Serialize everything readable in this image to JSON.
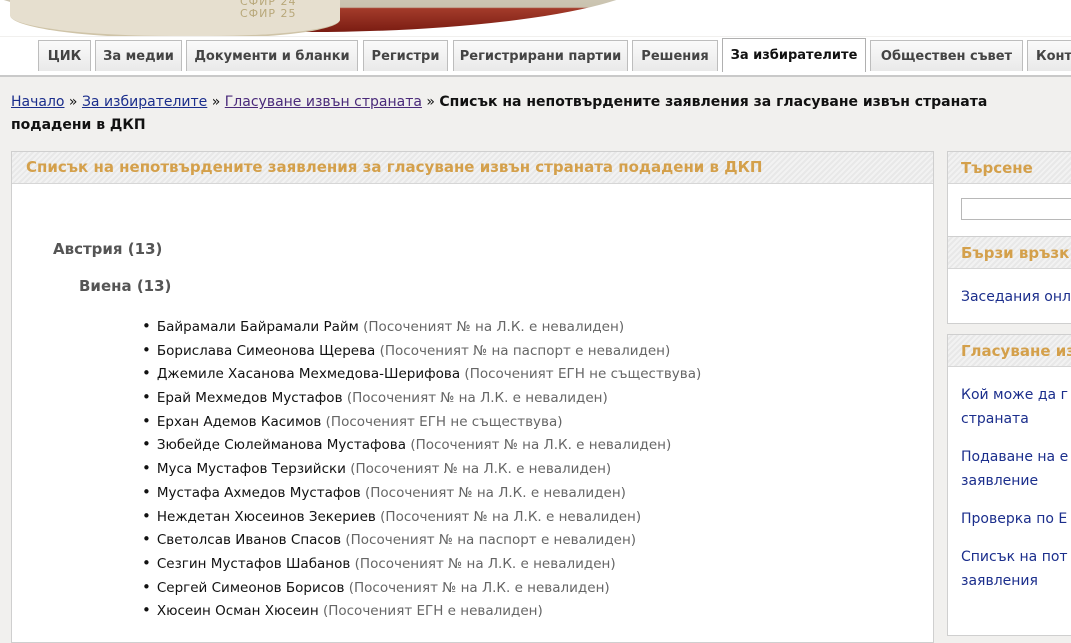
{
  "banner": {
    "logo_text_1": "СФИР 24",
    "logo_text_2": "СФИР 25"
  },
  "tabs": [
    {
      "label": "ЦИК",
      "active": false
    },
    {
      "label": "За медии",
      "active": false
    },
    {
      "label": "Документи и бланки",
      "active": false
    },
    {
      "label": "Регистри",
      "active": false
    },
    {
      "label": "Регистрирани партии",
      "active": false
    },
    {
      "label": "Решения",
      "active": false
    },
    {
      "label": "За избирателите",
      "active": true
    },
    {
      "label": "Обществен съвет",
      "active": false
    },
    {
      "label": "Конт",
      "active": false
    }
  ],
  "breadcrumb": {
    "home": "Начало",
    "sep": " » ",
    "voters": "За избирателите",
    "abroad": "Гласуване извън страната",
    "current": "Списък на непотвърдените заявления за гласуване извън страната подадени в ДКП"
  },
  "main": {
    "title": "Списък на непотвърдените заявления за гласуване извън страната подадени в ДКП",
    "country": "Австрия (13)",
    "city": "Виена (13)",
    "entries": [
      {
        "name": "Байрамали Байрамали Райм",
        "reason": "(Посоченият № на Л.К. е невалиден)"
      },
      {
        "name": "Борислава Симеонова Щерева",
        "reason": "(Посоченият № на паспорт е невалиден)"
      },
      {
        "name": "Джемиле Хасанова Мехмедова-Шерифова",
        "reason": "(Посоченият ЕГН не съществува)"
      },
      {
        "name": "Ерай Мехмедов Мустафов",
        "reason": "(Посоченият № на Л.К. е невалиден)"
      },
      {
        "name": "Ерхан Адемов Касимов",
        "reason": "(Посоченият ЕГН не съществува)"
      },
      {
        "name": "Зюбейде Сюлейманова Мустафова",
        "reason": "(Посоченият № на Л.К. е невалиден)"
      },
      {
        "name": "Муса Мустафов Терзийски",
        "reason": "(Посоченият № на Л.К. е невалиден)"
      },
      {
        "name": "Мустафа Ахмедов Мустафов",
        "reason": "(Посоченият № на Л.К. е невалиден)"
      },
      {
        "name": "Неждетан Хюсеинов Зекериев",
        "reason": "(Посоченият № на Л.К. е невалиден)"
      },
      {
        "name": "Светолсав Иванов Спасов",
        "reason": "(Посоченият № на паспорт е невалиден)"
      },
      {
        "name": "Сезгин Мустафов Шабанов",
        "reason": "(Посоченият № на Л.К. е невалиден)"
      },
      {
        "name": "Сергей Симеонов Борисов",
        "reason": "(Посоченият № на Л.К. е невалиден)"
      },
      {
        "name": "Хюсеин Осман Хюсеин",
        "reason": "(Посоченият ЕГН е невалиден)"
      }
    ]
  },
  "sidebar": {
    "search_title": "Търсене",
    "quick_title": "Бързи връзк",
    "quick_links": [
      "Заседания онл"
    ],
    "abroad_title": "Гласуване из",
    "abroad_links": [
      "Кой може да г",
      "страната",
      "Подаване на е",
      "заявление",
      "Проверка по Е",
      "Списък на пот",
      "заявления"
    ]
  }
}
